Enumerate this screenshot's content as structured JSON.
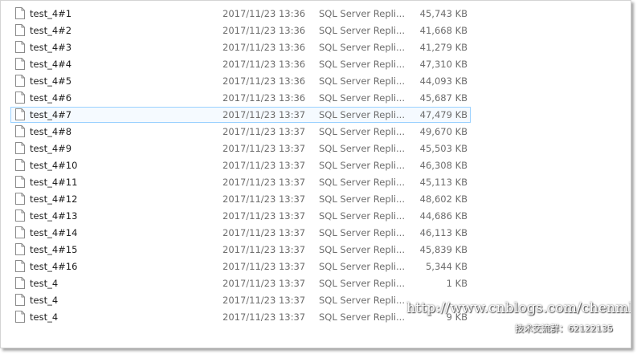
{
  "files": [
    {
      "name": "test_4#1",
      "date": "2017/11/23 13:36",
      "type": "SQL Server Repli...",
      "size": "45,743 KB"
    },
    {
      "name": "test_4#2",
      "date": "2017/11/23 13:36",
      "type": "SQL Server Repli...",
      "size": "41,668 KB"
    },
    {
      "name": "test_4#3",
      "date": "2017/11/23 13:36",
      "type": "SQL Server Repli...",
      "size": "41,279 KB"
    },
    {
      "name": "test_4#4",
      "date": "2017/11/23 13:36",
      "type": "SQL Server Repli...",
      "size": "47,310 KB"
    },
    {
      "name": "test_4#5",
      "date": "2017/11/23 13:36",
      "type": "SQL Server Repli...",
      "size": "44,093 KB"
    },
    {
      "name": "test_4#6",
      "date": "2017/11/23 13:36",
      "type": "SQL Server Repli...",
      "size": "45,687 KB"
    },
    {
      "name": "test_4#7",
      "date": "2017/11/23 13:37",
      "type": "SQL Server Repli...",
      "size": "47,479 KB",
      "selected": true
    },
    {
      "name": "test_4#8",
      "date": "2017/11/23 13:37",
      "type": "SQL Server Repli...",
      "size": "49,670 KB"
    },
    {
      "name": "test_4#9",
      "date": "2017/11/23 13:37",
      "type": "SQL Server Repli...",
      "size": "45,503 KB"
    },
    {
      "name": "test_4#10",
      "date": "2017/11/23 13:37",
      "type": "SQL Server Repli...",
      "size": "46,308 KB"
    },
    {
      "name": "test_4#11",
      "date": "2017/11/23 13:37",
      "type": "SQL Server Repli...",
      "size": "45,113 KB"
    },
    {
      "name": "test_4#12",
      "date": "2017/11/23 13:37",
      "type": "SQL Server Repli...",
      "size": "48,602 KB"
    },
    {
      "name": "test_4#13",
      "date": "2017/11/23 13:37",
      "type": "SQL Server Repli...",
      "size": "44,686 KB"
    },
    {
      "name": "test_4#14",
      "date": "2017/11/23 13:37",
      "type": "SQL Server Repli...",
      "size": "46,113 KB"
    },
    {
      "name": "test_4#15",
      "date": "2017/11/23 13:37",
      "type": "SQL Server Repli...",
      "size": "45,839 KB"
    },
    {
      "name": "test_4#16",
      "date": "2017/11/23 13:37",
      "type": "SQL Server Repli...",
      "size": "5,344 KB"
    },
    {
      "name": "test_4",
      "date": "2017/11/23 13:37",
      "type": "SQL Server Repli...",
      "size": "1 KB"
    },
    {
      "name": "test_4",
      "date": "2017/11/23 13:37",
      "type": "SQL Server Repli...",
      "size": ""
    },
    {
      "name": "test_4",
      "date": "2017/11/23 13:37",
      "type": "SQL Server Repli...",
      "size": "9 KB"
    }
  ],
  "file_icon": "document-file-icon",
  "selection_border_color": "#99d1ff",
  "selection_fill_color": "#f5faff",
  "watermark": {
    "url": "http://www.cnblogs.com/chenmh/",
    "group": "技术交流群：62122135"
  }
}
